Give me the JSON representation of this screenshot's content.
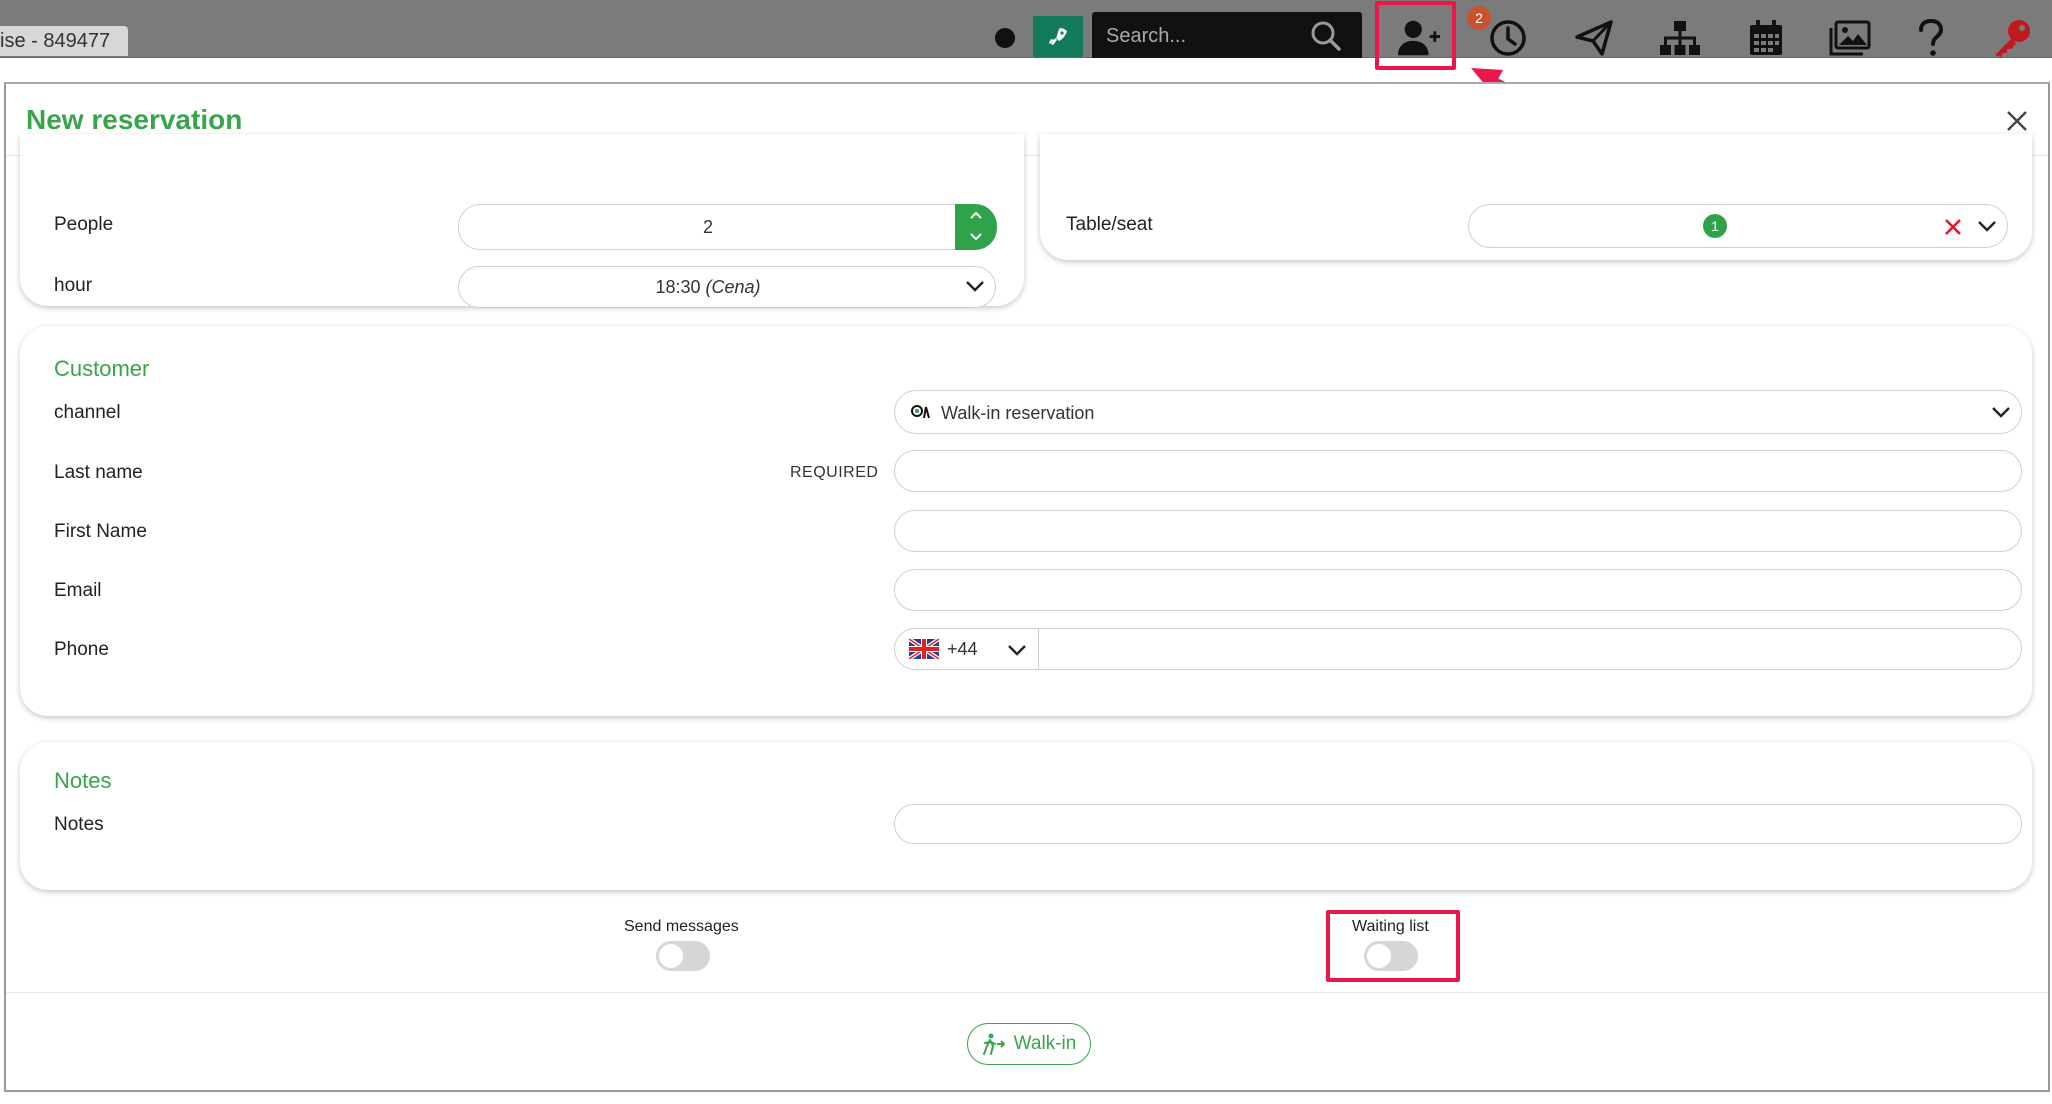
{
  "topbar": {
    "title": "ise - 849477",
    "search_placeholder": "Search...",
    "notification_count": "2",
    "icons": [
      "rocket-icon",
      "search-icon",
      "add-user-icon",
      "clock-icon",
      "send-icon",
      "sitemap-icon",
      "calendar-icon",
      "gallery-icon",
      "help-icon",
      "key-icon"
    ]
  },
  "modal": {
    "title": "New reservation",
    "booking": {
      "people_label": "People",
      "people_value": "2",
      "hour_label": "hour",
      "hour_value": "18:30",
      "hour_service": "(Cena)",
      "table_label": "Table/seat",
      "table_value": "1"
    },
    "customer": {
      "section_title": "Customer",
      "channel_label": "channel",
      "channel_value": "Walk-in reservation",
      "last_name_label": "Last name",
      "required_text": "REQUIRED",
      "first_name_label": "First Name",
      "email_label": "Email",
      "phone_label": "Phone",
      "phone_prefix": "+44"
    },
    "notes": {
      "section_title": "Notes",
      "notes_label": "Notes"
    },
    "toggles": {
      "send_messages_label": "Send messages",
      "waiting_list_label": "Waiting list"
    },
    "footer": {
      "walkin_label": "Walk-in"
    }
  },
  "colors": {
    "accent_green": "#38a54a",
    "highlight_red": "#e8194a",
    "topbar_gray": "#7b7b7b"
  }
}
